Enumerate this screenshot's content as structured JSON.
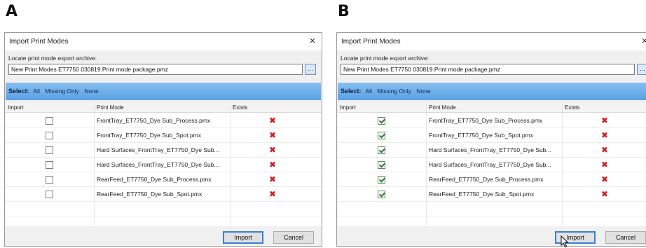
{
  "panels": [
    {
      "letter": "A",
      "dialog": {
        "title": "Import Print Modes",
        "close_glyph": "×",
        "locate_label": "Locate print mode export archive:",
        "path_value": "New Print Modes ET7750 030819.Print mode package.pmz",
        "browse_label": "...",
        "select_label": "Select:",
        "select_options": [
          "All",
          "Missing Only",
          "None"
        ],
        "columns": [
          "Import",
          "Print Mode",
          "Exists"
        ],
        "rows": [
          {
            "checked": false,
            "mode": "FrontTray_ET7750_Dye Sub_Process.pmx",
            "exists": "✖"
          },
          {
            "checked": false,
            "mode": "FrontTray_ET7750_Dye Sub_Spot.pmx",
            "exists": "✖"
          },
          {
            "checked": false,
            "mode": "Hard Surfaces_FrontTray_ET7750_Dye Sub...",
            "exists": "✖"
          },
          {
            "checked": false,
            "mode": "Hard Surfaces_FrontTray_ET7750_Dye Sub...",
            "exists": "✖"
          },
          {
            "checked": false,
            "mode": "RearFeed_ET7750_Dye Sub_Process.pmx",
            "exists": "✖"
          },
          {
            "checked": false,
            "mode": "RearFeed_ET7750_Dye Sub_Spot.pmx",
            "exists": "✖"
          }
        ],
        "import_label": "Import",
        "cancel_label": "Cancel"
      }
    },
    {
      "letter": "B",
      "dialog": {
        "title": "Import Print Modes",
        "close_glyph": "×",
        "locate_label": "Locate print mode export archive:",
        "path_value": "New Print Modes ET7750 030819.Print mode package.pmz",
        "browse_label": "...",
        "select_label": "Select:",
        "select_options": [
          "All",
          "Missing Only",
          "None"
        ],
        "columns": [
          "Import",
          "Print Mode",
          "Exists"
        ],
        "rows": [
          {
            "checked": true,
            "mode": "FrontTray_ET7750_Dye Sub_Process.pmx",
            "exists": "✖"
          },
          {
            "checked": true,
            "mode": "FrontTray_ET7750_Dye Sub_Spot.pmx",
            "exists": "✖"
          },
          {
            "checked": true,
            "mode": "Hard Surfaces_FrontTray_ET7750_Dye Sub...",
            "exists": "✖"
          },
          {
            "checked": true,
            "mode": "Hard Surfaces_FrontTray_ET7750_Dye Sub...",
            "exists": "✖"
          },
          {
            "checked": true,
            "mode": "RearFeed_ET7750_Dye Sub_Process.pmx",
            "exists": "✖"
          },
          {
            "checked": true,
            "mode": "RearFeed_ET7750_Dye Sub_Spot.pmx",
            "exists": "✖"
          }
        ],
        "import_label": "Import",
        "cancel_label": "Cancel"
      }
    }
  ],
  "colors": {
    "select_bar": "#5ba0e3",
    "exists_x": "#d42020",
    "check": "#2d7a2d",
    "default_button_border": "#3c7fd8"
  },
  "icons": {
    "close": "close-icon",
    "exists": "x-mark-icon",
    "cursor": "mouse-pointer-icon"
  }
}
